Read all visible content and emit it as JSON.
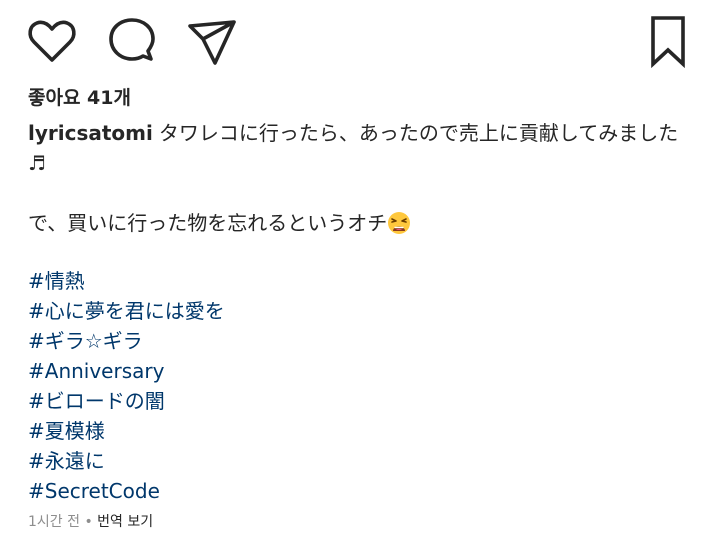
{
  "actions": {
    "like_icon": "heart-outline-icon",
    "comment_icon": "comment-bubble-icon",
    "share_icon": "paper-plane-icon",
    "save_icon": "bookmark-outline-icon"
  },
  "likes": {
    "label": "좋아요 41개"
  },
  "caption": {
    "username": "lyricsatomi",
    "line1": "タワレコに行ったら、あったので売上に貢献してみました♬",
    "line2": "で、買いに行った物を忘れるというオチ",
    "line2_emoji": "tired-face-emoji"
  },
  "hashtags": [
    "#情熱",
    "#心に夢を君には愛を",
    "#ギラ☆ギラ",
    "#Anniversary",
    "#ビロードの闇",
    "#夏模様",
    "#永遠に",
    "#SecretCode"
  ],
  "meta": {
    "time": "1시간 전",
    "separator": "•",
    "translate": "번역 보기"
  },
  "colors": {
    "text": "#262626",
    "hashtag": "#00376b",
    "muted": "#8e8e8e"
  }
}
